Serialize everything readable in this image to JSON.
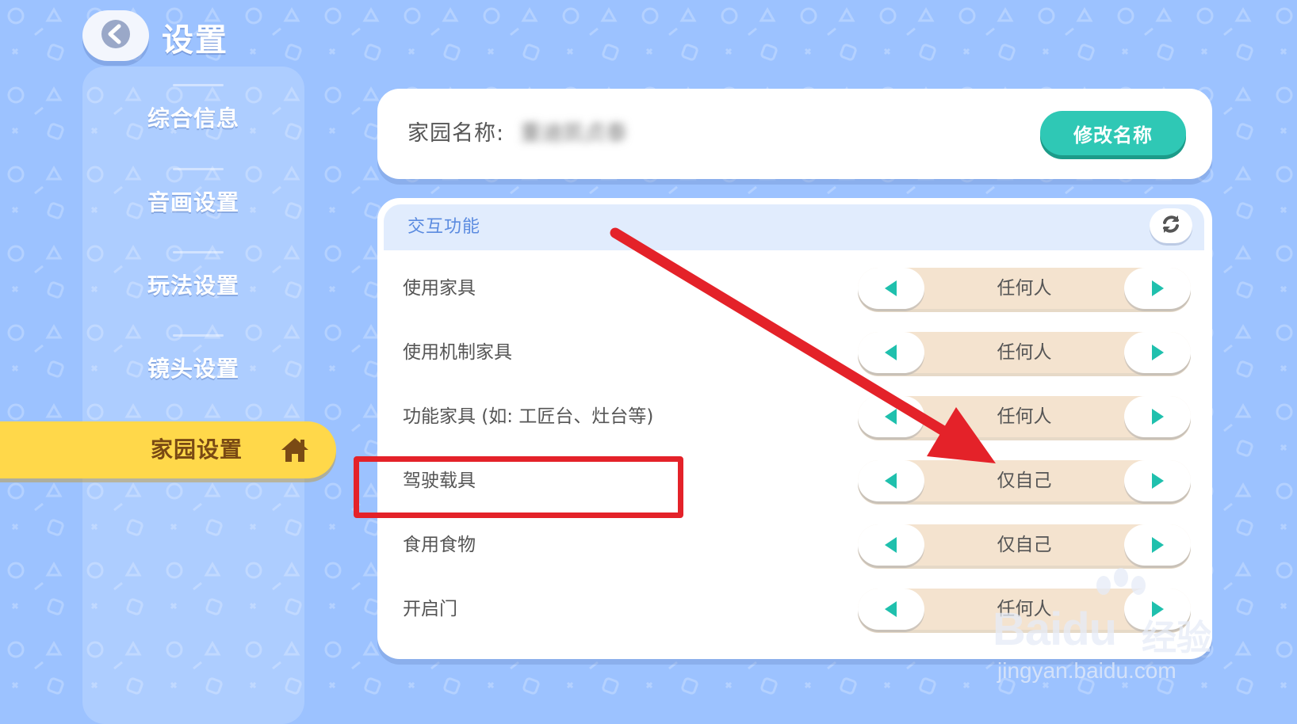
{
  "header": {
    "back_icon": "chevron-left-icon",
    "title": "设置"
  },
  "sidebar": {
    "items": [
      {
        "label": "综合信息",
        "active": false
      },
      {
        "label": "音画设置",
        "active": false
      },
      {
        "label": "玩法设置",
        "active": false
      },
      {
        "label": "镜头设置",
        "active": false
      },
      {
        "label": "家园设置",
        "active": true,
        "icon": "home-icon"
      }
    ]
  },
  "home_name": {
    "label": "家园名称:",
    "value": "重迪凯贞泰",
    "value_blurred": true,
    "rename_button": "修改名称"
  },
  "interaction": {
    "section_title": "交互功能",
    "refresh_icon": "refresh-icon",
    "rows": [
      {
        "label": "使用家具",
        "value": "任何人"
      },
      {
        "label": "使用机制家具",
        "value": "任何人"
      },
      {
        "label": "功能家具 (如: 工匠台、灶台等)",
        "value": "任何人"
      },
      {
        "label": "驾驶载具",
        "value": "仅自己"
      },
      {
        "label": "食用食物",
        "value": "仅自己"
      },
      {
        "label": "开启门",
        "value": "任何人"
      }
    ]
  },
  "annotation": {
    "highlight_color": "#e42229",
    "arrow_color": "#e42229"
  },
  "watermark": {
    "brand": "Baidu",
    "brand_cn": "经验",
    "url": "jingyan.baidu.com"
  },
  "colors": {
    "background": "#9cc2ff",
    "accent_teal": "#2fc8b5",
    "active_yellow": "#ffd84a",
    "stepper_bg": "#f4e3cf"
  }
}
